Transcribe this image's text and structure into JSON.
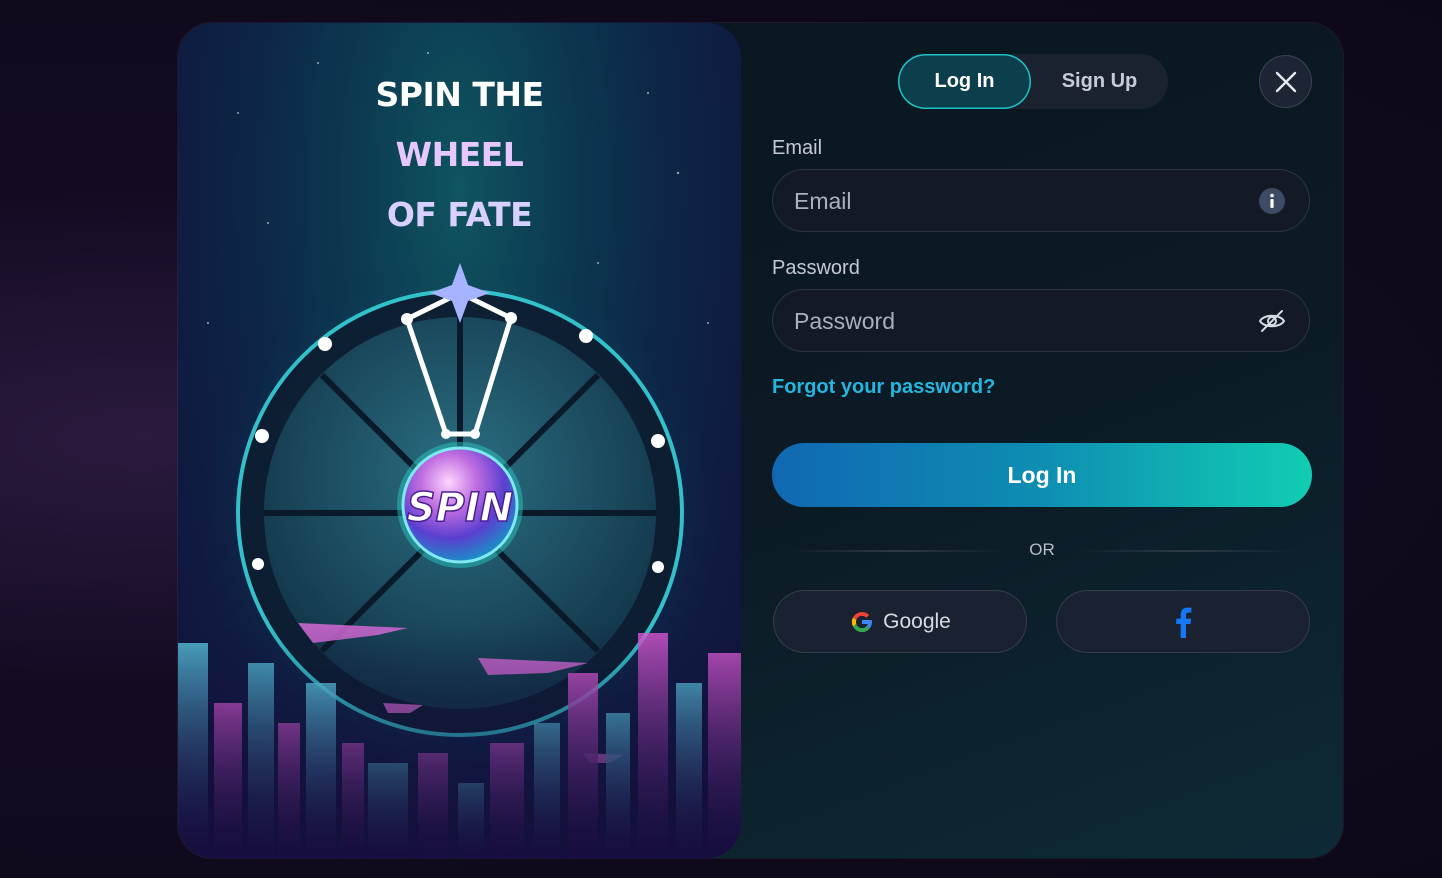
{
  "promo": {
    "line1": "SPIN THE",
    "line2": "WHEEL",
    "line3": "OF FATE",
    "spin_label": "SPIN"
  },
  "tabs": {
    "login": "Log In",
    "signup": "Sign Up",
    "active": "login"
  },
  "form": {
    "email_label": "Email",
    "email_placeholder": "Email",
    "email_value": "",
    "password_label": "Password",
    "password_placeholder": "Password",
    "password_value": "",
    "forgot_link": "Forgot your password?",
    "submit_label": "Log In",
    "divider": "OR"
  },
  "social": {
    "google_label": "Google",
    "google_icon": "google-icon",
    "facebook_icon": "facebook-icon"
  },
  "icons": {
    "close": "close-icon",
    "email_info": "info-icon",
    "password_toggle": "eye-off-icon"
  },
  "colors": {
    "accent_teal": "#11cdb3",
    "accent_blue": "#1168b2",
    "link": "#25b6e0",
    "title_purple": "#e6c8ff"
  }
}
